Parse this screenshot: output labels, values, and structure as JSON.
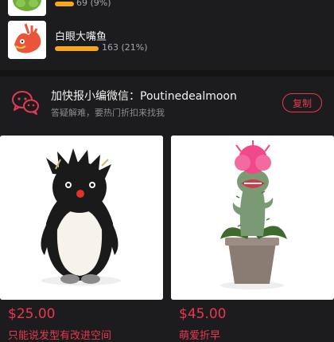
{
  "poll": {
    "items": [
      {
        "stat": "69 (9%)",
        "share": 0.09,
        "icon": "green-plush-thumbnail"
      },
      {
        "label": "白眼大嘴鱼",
        "stat": "163 (21%)",
        "share": 0.21,
        "icon": "fish-plush-thumbnail"
      }
    ],
    "bar_color": "#f5a623"
  },
  "wechat": {
    "title": "加快报小编微信：Poutinedealmoon",
    "subtitle": "答疑解难，要热门折扣来找我",
    "copy_label": "复制",
    "icon": "wechat-chat-icon",
    "accent": "#e23a52"
  },
  "products": [
    {
      "price": "$25.00",
      "title": "只能说发型有改进空间",
      "image": "penguin-plush-image"
    },
    {
      "price": "$45.00",
      "title": "萌爱折早",
      "image": "cactus-plush-image"
    }
  ],
  "price_color": "#e8384f"
}
